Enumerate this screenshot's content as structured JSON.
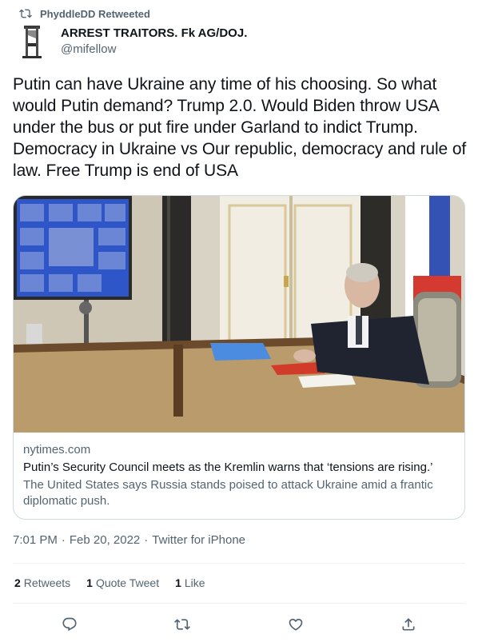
{
  "retweet": {
    "label": "PhyddleDD Retweeted"
  },
  "author": {
    "display_name": "ARREST TRAITORS. Fk AG/DOJ.",
    "handle": "@mifellow"
  },
  "tweet": {
    "text": "Putin can have Ukraine any time of his choosing. So what would Putin demand? Trump 2.0. Would Biden throw USA under the bus or put fire under Garland to indict Trump. Democracy in Ukraine vs Our republic, democracy and rule of law. Free Trump is end of USA"
  },
  "card": {
    "domain": "nytimes.com",
    "title": "Putin’s Security Council meets as the Kremlin warns that ‘tensions are rising.’",
    "description": "The United States says Russia stands poised to attack Ukraine amid a frantic diplomatic push."
  },
  "meta": {
    "time": "7:01 PM",
    "date": "Feb 20, 2022",
    "source": "Twitter for iPhone",
    "separator": "·"
  },
  "stats": {
    "retweets": {
      "count": "2",
      "label": "Retweets"
    },
    "quotes": {
      "count": "1",
      "label": "Quote Tweet"
    },
    "likes": {
      "count": "1",
      "label": "Like"
    }
  },
  "actions": [
    {
      "icon": "reply-icon"
    },
    {
      "icon": "retweet-icon"
    },
    {
      "icon": "like-icon"
    },
    {
      "icon": "share-icon"
    }
  ],
  "colors": {
    "text": "#0f1419",
    "secondary": "#536471",
    "border": "#cfd9de"
  }
}
